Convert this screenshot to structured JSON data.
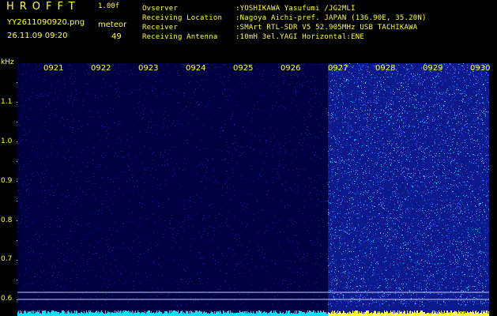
{
  "header": {
    "app_title": "HROFFT",
    "version": "1.00f",
    "filename": "YY2611090920.png",
    "detector_label": "meteor",
    "datetime": "26.11.09 09:20",
    "meteor_count": "49"
  },
  "info": [
    {
      "label": "Ovserver",
      "value": ":YOSHIKAWA Yasufumi /JG2MLI"
    },
    {
      "label": "Receiving Location",
      "value": ":Nagoya Aichi-pref. JAPAN (136.90E, 35.20N)"
    },
    {
      "label": "Receiver",
      "value": ":SMArt RTL-SDR V5 52.905MHz USB TACHIKAWA"
    },
    {
      "label": "Receiving Antenna",
      "value": ":10mH 3el.YAGI Horizontal:ENE"
    }
  ],
  "axis": {
    "y_unit": "kHz",
    "y_ticks": [
      "1.1",
      "1.0",
      "0.9",
      "0.8",
      "0.7",
      "0.6"
    ],
    "x_ticks": [
      "0921",
      "0922",
      "0923",
      "0924",
      "0925",
      "0926",
      "0927",
      "0928",
      "0929",
      "0930"
    ]
  },
  "spectrogram": {
    "background_color": "#000040",
    "noise_color_low": "#1a2aa8",
    "noise_color_high": "#3fd0ff",
    "active_from_minute": "0927",
    "baseline_color": "#00e5ff",
    "baseline_active_color": "#ffff40",
    "guide_line_color": "#c8c8ff"
  }
}
